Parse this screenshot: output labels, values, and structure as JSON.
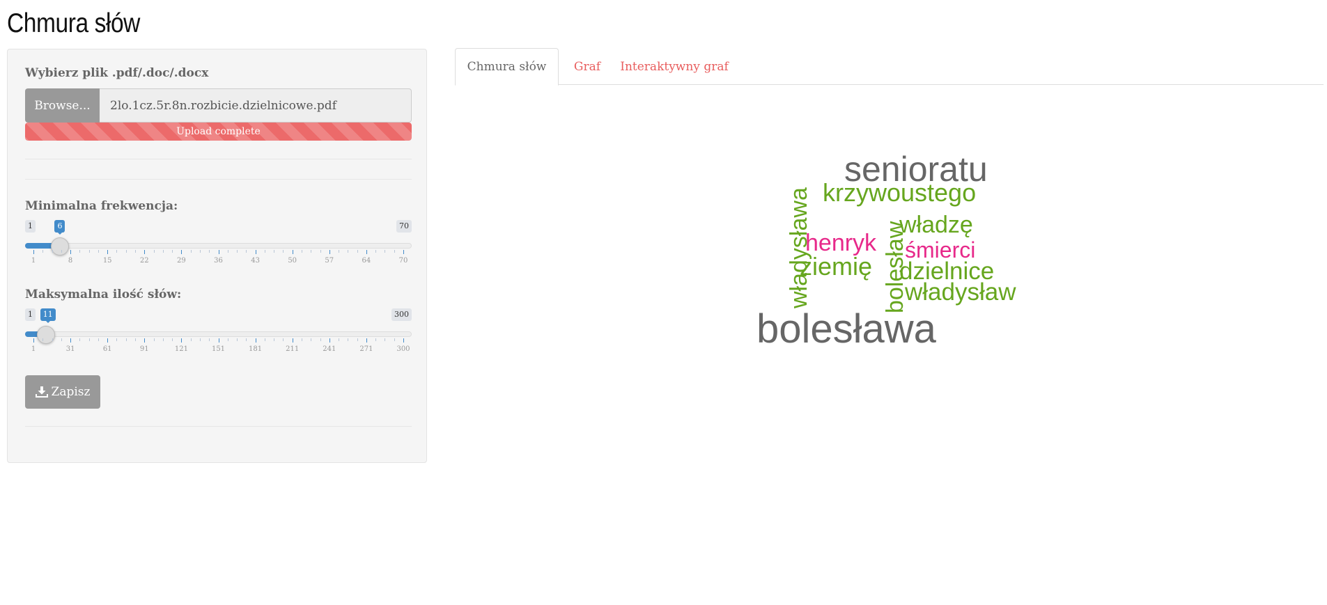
{
  "page": {
    "title": "Chmura słów"
  },
  "sidebar": {
    "file_label": "Wybierz plik .pdf/.doc/.docx",
    "browse_label": "Browse...",
    "file_name": "2lo.1cz.5r.8n.rozbicie.dzielnicowe.pdf",
    "upload_status": "Upload complete",
    "upload_progress_percent": 100,
    "min_freq": {
      "label": "Minimalna frekwencja:",
      "min": 1,
      "max": 70,
      "value": 6,
      "min_label": "1",
      "max_label": "70",
      "value_label": "6",
      "ticks": [
        "1",
        "8",
        "15",
        "22",
        "29",
        "36",
        "43",
        "50",
        "57",
        "64",
        "70"
      ]
    },
    "max_words": {
      "label": "Maksymalna ilość słów:",
      "min": 1,
      "max": 300,
      "value": 11,
      "min_label": "1",
      "max_label": "300",
      "value_label": "11",
      "ticks": [
        "1",
        "31",
        "61",
        "91",
        "121",
        "151",
        "181",
        "211",
        "241",
        "271",
        "300"
      ]
    },
    "save_label": "Zapisz"
  },
  "tabs": [
    {
      "label": "Chmura słów",
      "active": true
    },
    {
      "label": "Graf",
      "active": false
    },
    {
      "label": "Interaktywny graf",
      "active": false
    }
  ],
  "colors": {
    "accent": "#428bca",
    "tab_link": "#e85d5d",
    "progress": "#ec6a6a",
    "word_gray": "#666666",
    "word_green": "#66a61e",
    "word_magenta": "#e7298a"
  },
  "word_cloud": {
    "words": [
      {
        "text": "senioratu",
        "color": "#666666"
      },
      {
        "text": "krzywoustego",
        "color": "#66a61e"
      },
      {
        "text": "władysława",
        "color": "#66a61e",
        "vertical": true
      },
      {
        "text": "władzę",
        "color": "#66a61e"
      },
      {
        "text": "henryk",
        "color": "#e7298a"
      },
      {
        "text": "bolesław",
        "color": "#66a61e",
        "vertical": true
      },
      {
        "text": "śmierci",
        "color": "#e7298a"
      },
      {
        "text": "ziemię",
        "color": "#66a61e"
      },
      {
        "text": "dzielnice",
        "color": "#66a61e"
      },
      {
        "text": "władysław",
        "color": "#66a61e"
      },
      {
        "text": "bolesława",
        "color": "#666666"
      }
    ]
  }
}
